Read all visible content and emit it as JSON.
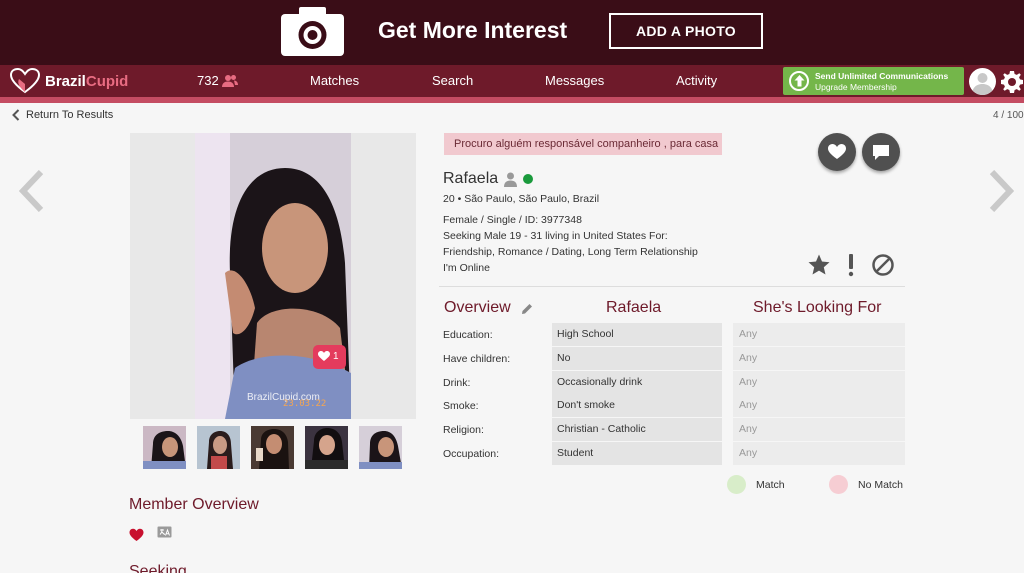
{
  "banner": {
    "headline": "Get More Interest",
    "add_photo_label": "ADD A PHOTO"
  },
  "nav": {
    "logo_part1": "Brazil",
    "logo_part2": "Cupid",
    "interest_count": "732",
    "links": [
      "Matches",
      "Search",
      "Messages",
      "Activity"
    ],
    "upgrade_title": "Send Unlimited Communications",
    "upgrade_sub": "Upgrade Membership"
  },
  "toolbar": {
    "back_label": "Return To Results",
    "counter": "4 / 100"
  },
  "profile": {
    "headline": "Procuro alguém responsável companheiro , para casa",
    "name": "Rafaela",
    "location": "20 • São Paulo, São Paulo, Brazil",
    "basics": "Female / Single / ID: 3977348",
    "seeking_1": "Seeking Male 19 - 31 living in United States For:",
    "seeking_2": "Friendship, Romance / Dating, Long Term Relationship",
    "online_status": "I'm Online",
    "photo_like_count": "1",
    "photo_watermark": "BrazilCupid.com",
    "photo_date": "23.03.22"
  },
  "overview": {
    "col1": "Overview",
    "col2": "Rafaela",
    "col3": "She's Looking For",
    "rows": [
      {
        "label": "Education:",
        "value": "High School",
        "seek": "Any"
      },
      {
        "label": "Have children:",
        "value": "No",
        "seek": "Any"
      },
      {
        "label": "Drink:",
        "value": "Occasionally drink",
        "seek": "Any"
      },
      {
        "label": "Smoke:",
        "value": "Don't smoke",
        "seek": "Any"
      },
      {
        "label": "Religion:",
        "value": "Christian - Catholic",
        "seek": "Any"
      },
      {
        "label": "Occupation:",
        "value": "Student",
        "seek": "Any"
      }
    ],
    "legend_match": "Match",
    "legend_nomatch": "No Match",
    "colors": {
      "match": "#d8edc9",
      "nomatch": "#f6cdd3"
    }
  },
  "member_overview": {
    "title": "Member Overview",
    "next_section_partial": "Seeking"
  },
  "colors": {
    "banner_bg": "#3a0d17",
    "nav_bg": "#6e1a2a",
    "accent": "#c44c62",
    "upgrade_green": "#74b64a",
    "online_green": "#1a9a3c"
  }
}
